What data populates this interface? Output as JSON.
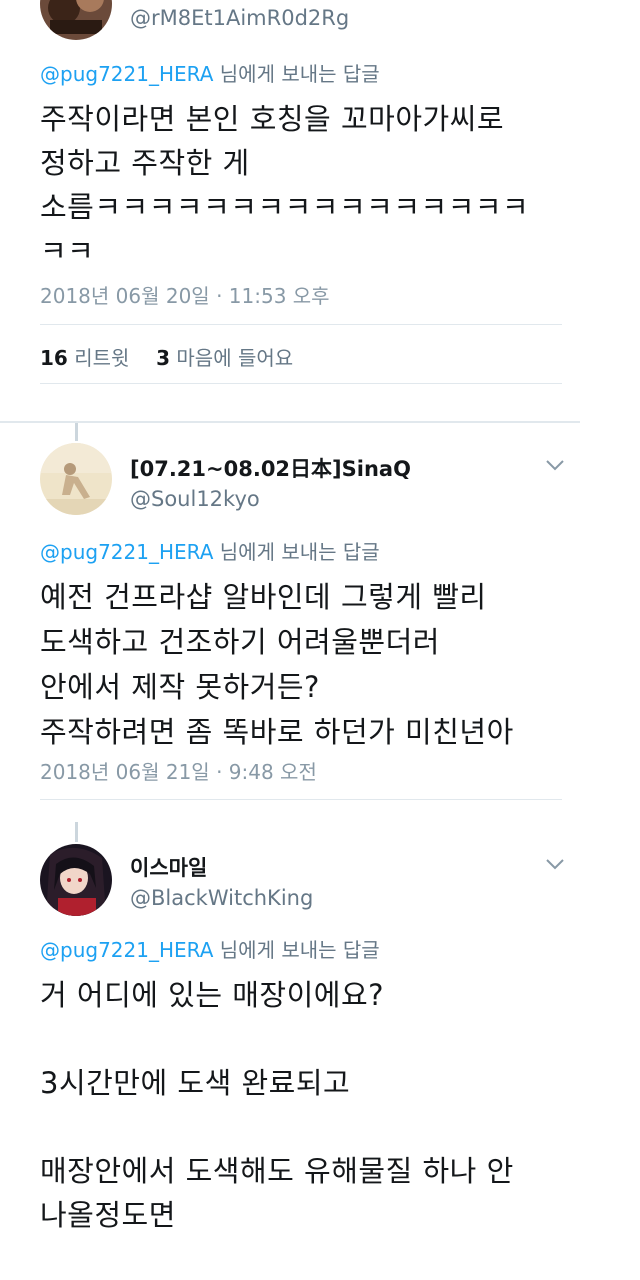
{
  "tweets": [
    {
      "handle": "@rM8Et1AimR0d2Rg",
      "reply_prefix": "@pug7221_HERA",
      "reply_suffix": " 님에게 보내는 답글",
      "body_lines": [
        "주작이라면 본인 호칭을 꼬마아가씨로",
        "정하고 주작한 게",
        "소름ㅋㅋㅋㅋㅋㅋㅋㅋㅋㅋㅋㅋㅋㅋㅋㅋ",
        "ㅋㅋ"
      ],
      "timestamp": "2018년 06월 20일 · 11:53 오후",
      "stats": {
        "retweets_count": "16",
        "retweets_label": " 리트윗",
        "likes_count": "3",
        "likes_label": " 마음에 들어요"
      }
    },
    {
      "display_name": "[07.21~08.02日本]SinaQ",
      "handle": "@Soul12kyo",
      "reply_prefix": "@pug7221_HERA",
      "reply_suffix": " 님에게 보내는 답글",
      "body_lines": [
        "예전 건프라샵 알바인데 그렇게 빨리",
        "도색하고 건조하기 어려울뿐더러",
        "안에서 제작 못하거든?",
        "주작하려면 좀 똑바로 하던가 미친년아"
      ],
      "timestamp": "2018년 06월 21일 · 9:48 오전"
    },
    {
      "display_name": "이스마일",
      "handle": "@BlackWitchKing",
      "reply_prefix": "@pug7221_HERA",
      "reply_suffix": " 님에게 보내는 답글",
      "body_lines": [
        "거 어디에 있는 매장이에요?",
        "",
        "3시간만에 도색 완료되고",
        "",
        "매장안에서 도색해도 유해물질 하나 안",
        "나올정도면"
      ]
    }
  ],
  "icons": {
    "chevron": "chevron-down-icon"
  },
  "colors": {
    "mention": "#1da1f2",
    "secondary_text": "#657786",
    "timestamp": "#8899a6",
    "divider": "#e1e8ed"
  }
}
